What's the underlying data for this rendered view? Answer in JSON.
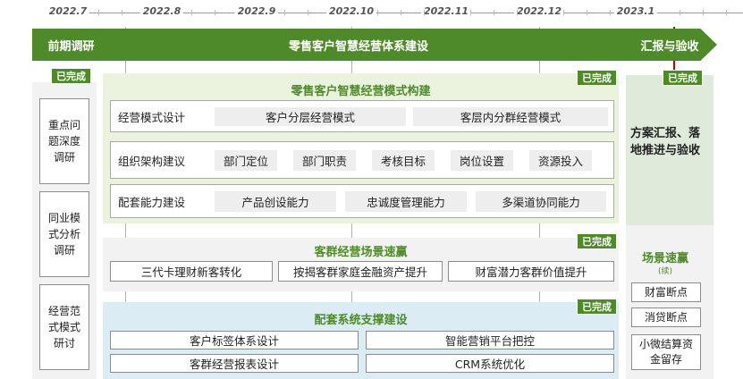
{
  "timeline": {
    "months": [
      "2022.7",
      "2022.8",
      "2022.9",
      "2022.10",
      "2022.11",
      "2022.12",
      "2023.1"
    ]
  },
  "phases": {
    "research": "前期调研",
    "construction": "零售客户智慧经营体系建设",
    "report": "汇报与验收"
  },
  "badge_done": "已完成",
  "left_items": [
    "重点问题深度调研",
    "同业模式分析调研",
    "经营范式模式研讨"
  ],
  "model_section": {
    "title": "零售客户智慧经营模式构建",
    "rows": [
      {
        "label": "经营模式设计",
        "items": [
          "客户分层经营模式",
          "客层内分群经营模式"
        ]
      },
      {
        "label": "组织架构建议",
        "items": [
          "部门定位",
          "部门职责",
          "考核目标",
          "岗位设置",
          "资源投入"
        ]
      },
      {
        "label": "配套能力建设",
        "items": [
          "产品创设能力",
          "忠诚度管理能力",
          "多渠道协同能力"
        ]
      }
    ]
  },
  "scene_section": {
    "title": "客群经营场景速赢",
    "items": [
      "三代卡理财新客转化",
      "按揭客群家庭金融资产提升",
      "财富潜力客群价值提升"
    ]
  },
  "system_section": {
    "title": "配套系统支撑建设",
    "items": [
      "客户标签体系设计",
      "智能营销平台把控",
      "客群经营报表设计",
      "CRM系统优化"
    ]
  },
  "right_column": {
    "report_text": "方案汇报、落地推进与验收",
    "scene_title": "场景速赢",
    "scene_subtitle": "(续)",
    "items": [
      "财富断点",
      "消贷断点",
      "小微结算资金留存"
    ]
  }
}
